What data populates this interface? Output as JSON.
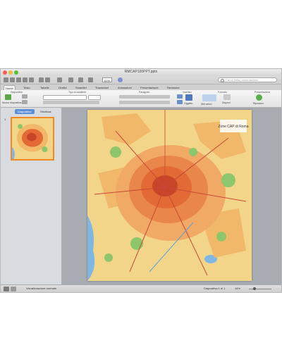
{
  "window": {
    "title": "RMCAP100PPT.pptx",
    "buttons": [
      "close",
      "minimize",
      "zoom"
    ],
    "toolbar_icons": [
      "new-icon",
      "template-icon",
      "open-icon",
      "save-icon",
      "print-icon",
      "undo-icon",
      "redo-icon",
      "format-icon",
      "slideshow-icon",
      "media-icon",
      "help-icon"
    ],
    "zoom_value": "61%",
    "search_placeholder": "Cerca nella presentazione"
  },
  "ribbon": {
    "tabs": [
      "Home",
      "Testo",
      "Tabelle",
      "Grafici",
      "SmartArt",
      "Transizioni",
      "Animazioni",
      "Presentazione",
      "Revisione"
    ],
    "active_tab": "Home",
    "groups": [
      "Diapositive",
      "Tipo di carattere",
      "Paragrafo",
      "Inserisci",
      "Formato",
      "Presentazione"
    ],
    "new_slide_label": "Nuova diapositiva",
    "shape_label": "Oggetto",
    "style_label": "Stili veloci",
    "arrange_label": "Disponi",
    "play_label": "Riproduci"
  },
  "sidebar": {
    "tabs": [
      "Diapositive",
      "Struttura"
    ],
    "active_tab": "Diapositive",
    "slide_number": "1"
  },
  "slide": {
    "map_title": "Zone CAP di Roma"
  },
  "status": {
    "view_label": "Visualizzazione normale",
    "slide_counter": "Diapositiva 1 di 1",
    "zoom": "44%"
  },
  "colors": {
    "accent": "#f08a24",
    "urban": "#e36a35",
    "suburb": "#f1b86a",
    "land": "#f3d58a",
    "park": "#8ec66c",
    "water": "#7fb7e2"
  }
}
